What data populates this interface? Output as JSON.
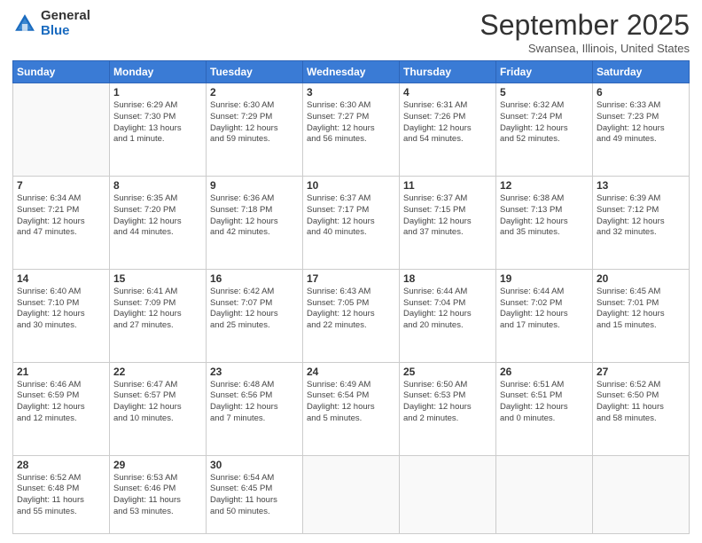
{
  "logo": {
    "general": "General",
    "blue": "Blue"
  },
  "header": {
    "month": "September 2025",
    "location": "Swansea, Illinois, United States"
  },
  "weekdays": [
    "Sunday",
    "Monday",
    "Tuesday",
    "Wednesday",
    "Thursday",
    "Friday",
    "Saturday"
  ],
  "weeks": [
    [
      {
        "day": "",
        "info": ""
      },
      {
        "day": "1",
        "info": "Sunrise: 6:29 AM\nSunset: 7:30 PM\nDaylight: 13 hours\nand 1 minute."
      },
      {
        "day": "2",
        "info": "Sunrise: 6:30 AM\nSunset: 7:29 PM\nDaylight: 12 hours\nand 59 minutes."
      },
      {
        "day": "3",
        "info": "Sunrise: 6:30 AM\nSunset: 7:27 PM\nDaylight: 12 hours\nand 56 minutes."
      },
      {
        "day": "4",
        "info": "Sunrise: 6:31 AM\nSunset: 7:26 PM\nDaylight: 12 hours\nand 54 minutes."
      },
      {
        "day": "5",
        "info": "Sunrise: 6:32 AM\nSunset: 7:24 PM\nDaylight: 12 hours\nand 52 minutes."
      },
      {
        "day": "6",
        "info": "Sunrise: 6:33 AM\nSunset: 7:23 PM\nDaylight: 12 hours\nand 49 minutes."
      }
    ],
    [
      {
        "day": "7",
        "info": "Sunrise: 6:34 AM\nSunset: 7:21 PM\nDaylight: 12 hours\nand 47 minutes."
      },
      {
        "day": "8",
        "info": "Sunrise: 6:35 AM\nSunset: 7:20 PM\nDaylight: 12 hours\nand 44 minutes."
      },
      {
        "day": "9",
        "info": "Sunrise: 6:36 AM\nSunset: 7:18 PM\nDaylight: 12 hours\nand 42 minutes."
      },
      {
        "day": "10",
        "info": "Sunrise: 6:37 AM\nSunset: 7:17 PM\nDaylight: 12 hours\nand 40 minutes."
      },
      {
        "day": "11",
        "info": "Sunrise: 6:37 AM\nSunset: 7:15 PM\nDaylight: 12 hours\nand 37 minutes."
      },
      {
        "day": "12",
        "info": "Sunrise: 6:38 AM\nSunset: 7:13 PM\nDaylight: 12 hours\nand 35 minutes."
      },
      {
        "day": "13",
        "info": "Sunrise: 6:39 AM\nSunset: 7:12 PM\nDaylight: 12 hours\nand 32 minutes."
      }
    ],
    [
      {
        "day": "14",
        "info": "Sunrise: 6:40 AM\nSunset: 7:10 PM\nDaylight: 12 hours\nand 30 minutes."
      },
      {
        "day": "15",
        "info": "Sunrise: 6:41 AM\nSunset: 7:09 PM\nDaylight: 12 hours\nand 27 minutes."
      },
      {
        "day": "16",
        "info": "Sunrise: 6:42 AM\nSunset: 7:07 PM\nDaylight: 12 hours\nand 25 minutes."
      },
      {
        "day": "17",
        "info": "Sunrise: 6:43 AM\nSunset: 7:05 PM\nDaylight: 12 hours\nand 22 minutes."
      },
      {
        "day": "18",
        "info": "Sunrise: 6:44 AM\nSunset: 7:04 PM\nDaylight: 12 hours\nand 20 minutes."
      },
      {
        "day": "19",
        "info": "Sunrise: 6:44 AM\nSunset: 7:02 PM\nDaylight: 12 hours\nand 17 minutes."
      },
      {
        "day": "20",
        "info": "Sunrise: 6:45 AM\nSunset: 7:01 PM\nDaylight: 12 hours\nand 15 minutes."
      }
    ],
    [
      {
        "day": "21",
        "info": "Sunrise: 6:46 AM\nSunset: 6:59 PM\nDaylight: 12 hours\nand 12 minutes."
      },
      {
        "day": "22",
        "info": "Sunrise: 6:47 AM\nSunset: 6:57 PM\nDaylight: 12 hours\nand 10 minutes."
      },
      {
        "day": "23",
        "info": "Sunrise: 6:48 AM\nSunset: 6:56 PM\nDaylight: 12 hours\nand 7 minutes."
      },
      {
        "day": "24",
        "info": "Sunrise: 6:49 AM\nSunset: 6:54 PM\nDaylight: 12 hours\nand 5 minutes."
      },
      {
        "day": "25",
        "info": "Sunrise: 6:50 AM\nSunset: 6:53 PM\nDaylight: 12 hours\nand 2 minutes."
      },
      {
        "day": "26",
        "info": "Sunrise: 6:51 AM\nSunset: 6:51 PM\nDaylight: 12 hours\nand 0 minutes."
      },
      {
        "day": "27",
        "info": "Sunrise: 6:52 AM\nSunset: 6:50 PM\nDaylight: 11 hours\nand 58 minutes."
      }
    ],
    [
      {
        "day": "28",
        "info": "Sunrise: 6:52 AM\nSunset: 6:48 PM\nDaylight: 11 hours\nand 55 minutes."
      },
      {
        "day": "29",
        "info": "Sunrise: 6:53 AM\nSunset: 6:46 PM\nDaylight: 11 hours\nand 53 minutes."
      },
      {
        "day": "30",
        "info": "Sunrise: 6:54 AM\nSunset: 6:45 PM\nDaylight: 11 hours\nand 50 minutes."
      },
      {
        "day": "",
        "info": ""
      },
      {
        "day": "",
        "info": ""
      },
      {
        "day": "",
        "info": ""
      },
      {
        "day": "",
        "info": ""
      }
    ]
  ]
}
